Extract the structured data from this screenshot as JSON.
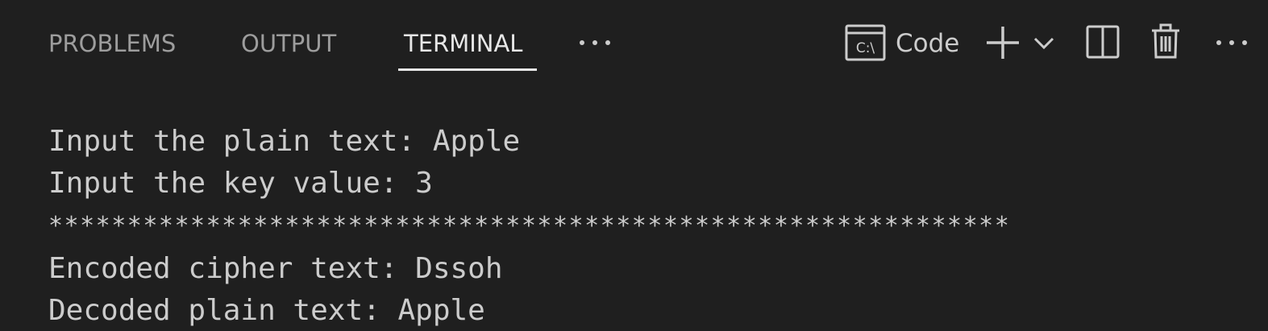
{
  "tabs": {
    "problems": "PROBLEMS",
    "output": "OUTPUT",
    "terminal": "TERMINAL",
    "more": "···"
  },
  "toolbar": {
    "shell_icon_text": "C:\\",
    "shell_label": "Code",
    "icons": [
      "terminal-shell-icon",
      "add-icon",
      "chevron-down-icon",
      "split-icon",
      "trash-icon",
      "more-icon"
    ]
  },
  "terminal": {
    "lines": [
      "Input the plain text: Apple",
      "Input the key value: 3",
      "*************************************************************",
      "Encoded cipher text: Dssoh",
      "Decoded plain text: Apple"
    ]
  },
  "colors": {
    "background": "#1f1f1f",
    "text": "#cccccc",
    "tab_inactive": "#9d9d9d",
    "tab_active": "#e7e7e7"
  }
}
